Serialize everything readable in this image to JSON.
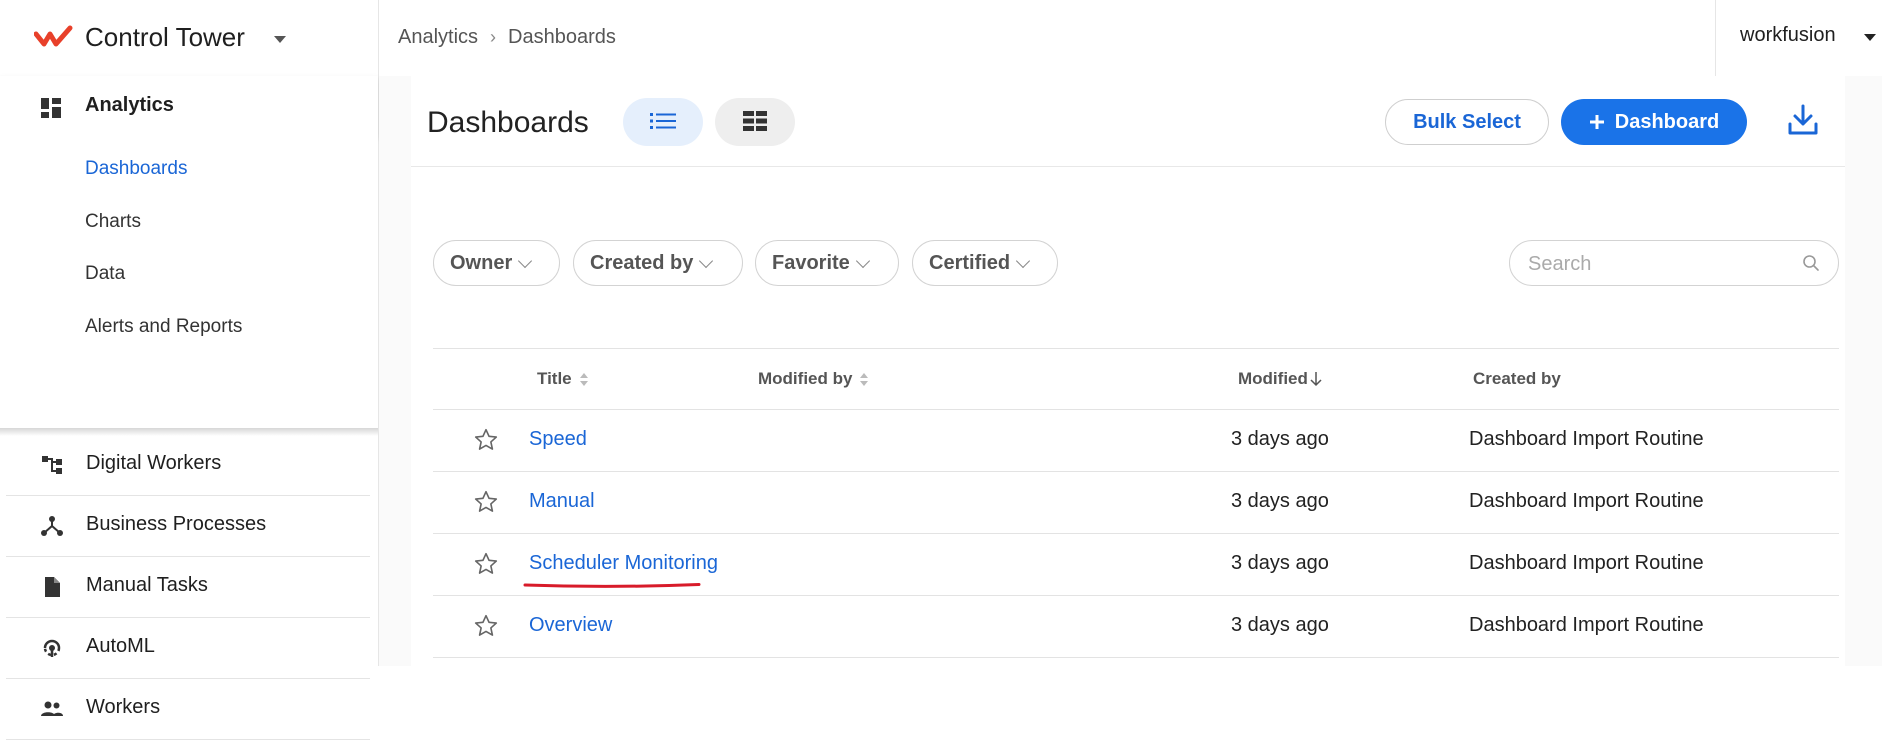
{
  "app": {
    "name": "Control Tower",
    "brand_color": "#e8402a"
  },
  "breadcrumb": {
    "items": [
      "Analytics",
      "Dashboards"
    ]
  },
  "user": {
    "name": "workfusion"
  },
  "sidebar": {
    "section": {
      "label": "Analytics",
      "icon": "dashboard-grid-icon"
    },
    "subitems": [
      {
        "label": "Dashboards",
        "active": true
      },
      {
        "label": "Charts"
      },
      {
        "label": "Data"
      },
      {
        "label": "Alerts and Reports"
      }
    ],
    "items": [
      {
        "label": "Digital Workers",
        "icon": "hierarchy-icon"
      },
      {
        "label": "Business Processes",
        "icon": "process-graph-icon"
      },
      {
        "label": "Manual Tasks",
        "icon": "document-icon"
      },
      {
        "label": "AutoML",
        "icon": "automl-icon"
      },
      {
        "label": "Workers",
        "icon": "people-icon"
      }
    ]
  },
  "page": {
    "title": "Dashboards",
    "bulk_select_label": "Bulk Select",
    "add_dashboard_label": "Dashboard",
    "accent": "#1a73e8"
  },
  "filters": [
    {
      "label": "Owner"
    },
    {
      "label": "Created by"
    },
    {
      "label": "Favorite"
    },
    {
      "label": "Certified"
    }
  ],
  "search": {
    "placeholder": "Search",
    "value": ""
  },
  "table": {
    "columns": {
      "title": "Title",
      "modified_by": "Modified by",
      "modified": "Modified",
      "created_by": "Created by"
    },
    "rows": [
      {
        "title": "Speed",
        "modified": "3 days ago",
        "created_by": "Dashboard Import Routine"
      },
      {
        "title": "Manual",
        "modified": "3 days ago",
        "created_by": "Dashboard Import Routine"
      },
      {
        "title": "Scheduler Monitoring",
        "modified": "3 days ago",
        "created_by": "Dashboard Import Routine"
      },
      {
        "title": "Overview",
        "modified": "3 days ago",
        "created_by": "Dashboard Import Routine"
      }
    ]
  }
}
